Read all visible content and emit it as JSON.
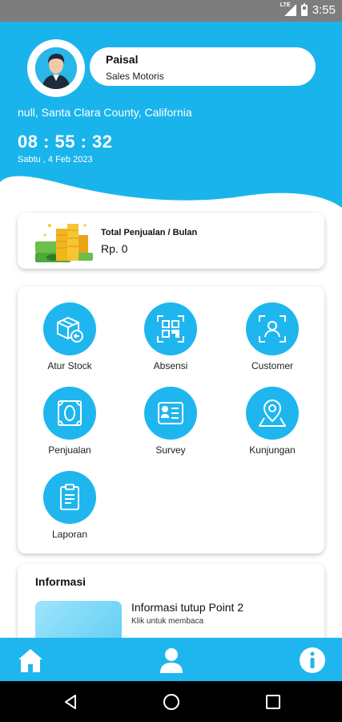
{
  "status_bar": {
    "clock": "3:55",
    "network_label": "LTE",
    "battery_level": 0.6
  },
  "colors": {
    "primary": "#1fb6ef",
    "header_blue": "#1ab4ec",
    "white": "#ffffff"
  },
  "profile": {
    "name": "Paisal",
    "role": "Sales Motoris",
    "avatar_icon": "user-avatar-icon"
  },
  "header": {
    "location": "null, Santa Clara County, California",
    "time": "08 : 55 : 32",
    "date": "Sabtu , 4 Feb 2023"
  },
  "sales": {
    "title": "Total Penjualan / Bulan",
    "value": "Rp. 0",
    "icon": "money-stack-icon"
  },
  "menu": {
    "items": [
      {
        "label": "Atur Stock",
        "icon": "stock-box-icon"
      },
      {
        "label": "Absensi",
        "icon": "qr-scan-icon"
      },
      {
        "label": "Customer",
        "icon": "customer-scan-icon"
      },
      {
        "label": "Penjualan",
        "icon": "cash-note-icon"
      },
      {
        "label": "Survey",
        "icon": "survey-form-icon"
      },
      {
        "label": "Kunjungan",
        "icon": "location-pin-icon"
      },
      {
        "label": "Laporan",
        "icon": "clipboard-icon"
      }
    ]
  },
  "info": {
    "title": "Informasi",
    "items": [
      {
        "headline": "Informasi tutup Point 2",
        "subtitle": "Klik untuk membaca"
      }
    ]
  },
  "bottom_nav": {
    "items": [
      {
        "icon": "home-icon"
      },
      {
        "icon": "profile-icon"
      },
      {
        "icon": "info-icon"
      }
    ]
  },
  "system_nav": {
    "items": [
      {
        "icon": "back-icon"
      },
      {
        "icon": "home-circle-icon"
      },
      {
        "icon": "recents-icon"
      }
    ]
  }
}
